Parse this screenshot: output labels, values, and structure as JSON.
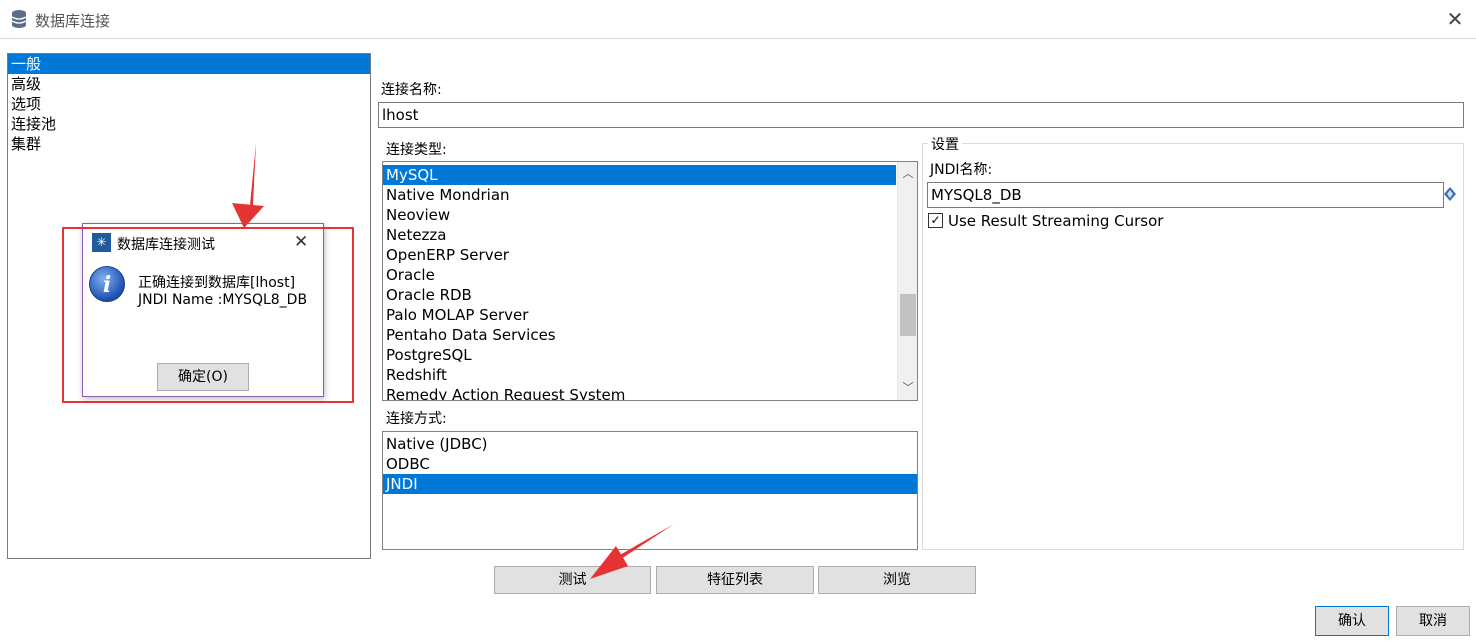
{
  "window": {
    "title": "数据库连接",
    "close_glyph": "✕"
  },
  "nav": {
    "items": [
      "一般",
      "高级",
      "选项",
      "连接池",
      "集群"
    ],
    "selected_index": 0
  },
  "connection_name": {
    "label": "连接名称:",
    "value": "lhost"
  },
  "connection_type": {
    "label": "连接类型:",
    "items": [
      "MySQL",
      "Native Mondrian",
      "Neoview",
      "Netezza",
      "OpenERP Server",
      "Oracle",
      "Oracle RDB",
      "Palo MOLAP Server",
      "Pentaho Data Services",
      "PostgreSQL",
      "Redshift",
      "Remedy Action Request System"
    ],
    "selected": "MySQL"
  },
  "access_method": {
    "label": "连接方式:",
    "items": [
      "Native (JDBC)",
      "ODBC",
      "JNDI"
    ],
    "selected": "JNDI"
  },
  "settings": {
    "title": "设置",
    "jndi_label": "JNDI名称:",
    "jndi_value": "MYSQL8_DB",
    "streaming_cursor_label": "Use Result Streaming Cursor",
    "streaming_cursor_checked": true
  },
  "buttons": {
    "test": "测试",
    "feature_list": "特征列表",
    "browse": "浏览",
    "ok": "确认",
    "cancel": "取消"
  },
  "test_dialog": {
    "title": "数据库连接测试",
    "message_line1": "正确连接到数据库[lhost]",
    "message_line2": "JNDI Name :MYSQL8_DB",
    "ok_button": "确定(O)"
  },
  "colors": {
    "selection": "#0078d7",
    "annotation": "#e53333"
  },
  "icons": [
    "database-icon",
    "close-icon",
    "info-icon",
    "chevron-up-icon",
    "chevron-down-icon",
    "checkmark-icon",
    "diamond-icon"
  ]
}
